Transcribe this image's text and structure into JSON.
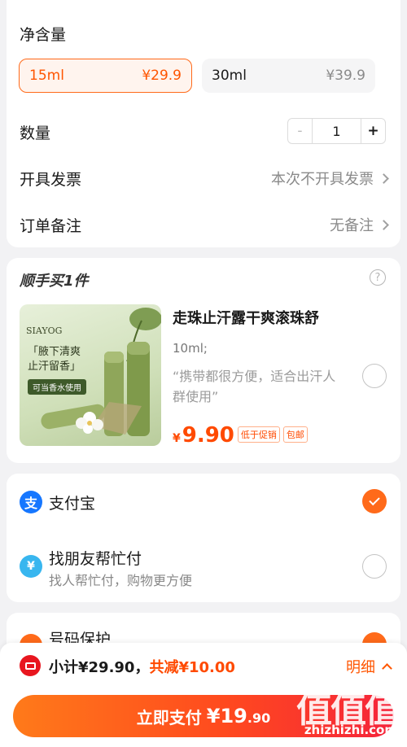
{
  "spec": {
    "label": "净含量",
    "options": [
      {
        "name": "15ml",
        "price": "¥29.9",
        "selected": true
      },
      {
        "name": "30ml",
        "price": "¥39.9",
        "selected": false
      }
    ]
  },
  "quantity": {
    "label": "数量",
    "value": "1",
    "minus": "-",
    "plus": "+"
  },
  "invoice": {
    "label": "开具发票",
    "value": "本次不开具发票"
  },
  "remark": {
    "label": "订单备注",
    "value": "无备注"
  },
  "addon": {
    "title": "顺手买1件",
    "help": "?",
    "product": {
      "name": "走珠止汗露干爽滚珠舒",
      "spec": "10ml;",
      "quote": "“携带都很方便，适合出汗人群使用”",
      "currency": "¥",
      "price": "9.90",
      "tags": [
        "低于促销",
        "包邮"
      ],
      "image_text": {
        "brand": "SIAYOG",
        "slogan": "「腋下清爽 止汗留香」",
        "badge": "可当香水使用"
      }
    }
  },
  "payment": {
    "methods": [
      {
        "name": "支付宝",
        "icon": "alipay-icon",
        "selected": true
      },
      {
        "name": "找朋友帮忙付",
        "sub": "找人帮忙付，购物更方便",
        "icon": "friend-pay-icon",
        "selected": false
      }
    ]
  },
  "partial_card": {
    "label": "号码保护"
  },
  "footer": {
    "subtotal": "小计¥29.90，",
    "discount": "共减¥10.00",
    "detail": "明细",
    "pay_label": "立即支付",
    "pay_currency": "¥",
    "pay_amount_int": "19",
    "pay_amount_dec": ".90"
  },
  "watermark": {
    "text": "值值值",
    "url": "zhizhizhi.com"
  },
  "colors": {
    "accent": "#ff5500",
    "alipay": "#1677ff",
    "friend": "#38b6ef"
  }
}
